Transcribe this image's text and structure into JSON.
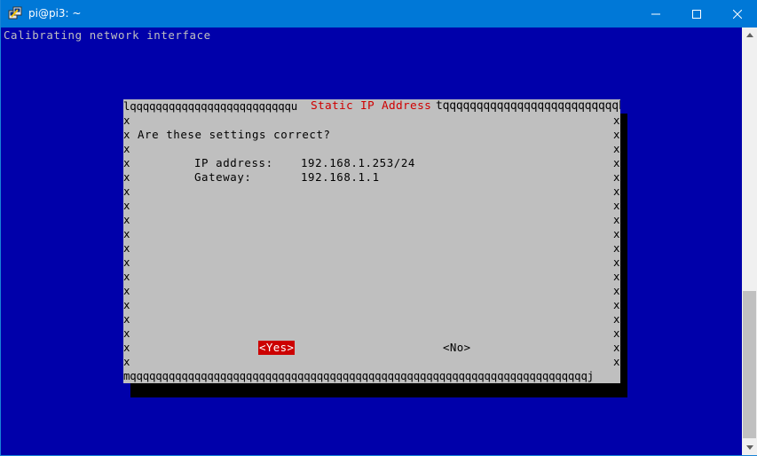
{
  "window": {
    "title": "pi@pi3: ~",
    "icon": "putty-icon",
    "controls": {
      "minimize": "minimize-icon",
      "maximize": "maximize-icon",
      "close": "close-icon"
    }
  },
  "terminal": {
    "status_line": "Calibrating network interface"
  },
  "dialog": {
    "border_top_left": "lqqqqqqqqqqqqqqqqqqqqqqqqqu",
    "title": "Static IP Address",
    "border_top_right": "tqqqqqqqqqqqqqqqqqqqqqqqqqqk",
    "border_bottom": "mqqqqqqqqqqqqqqqqqqqqqqqqqqqqqqqqqqqqqqqqqqqqqqqqqqqqqqqqqqqqqqqqqqqqqqqj",
    "side_char": "x",
    "question": "Are these settings correct?",
    "fields": [
      {
        "label": "IP address:",
        "value": "192.168.1.253/24"
      },
      {
        "label": "Gateway:",
        "value": "192.168.1.1"
      }
    ],
    "buttons": {
      "yes": "<Yes>",
      "no": "<No>"
    }
  },
  "colors": {
    "terminal_bg": "#0000aa",
    "titlebar": "#0078d7",
    "dialog_bg": "#bfbfbf",
    "dialog_title": "#d00000",
    "selected_button": "#cc0000"
  }
}
